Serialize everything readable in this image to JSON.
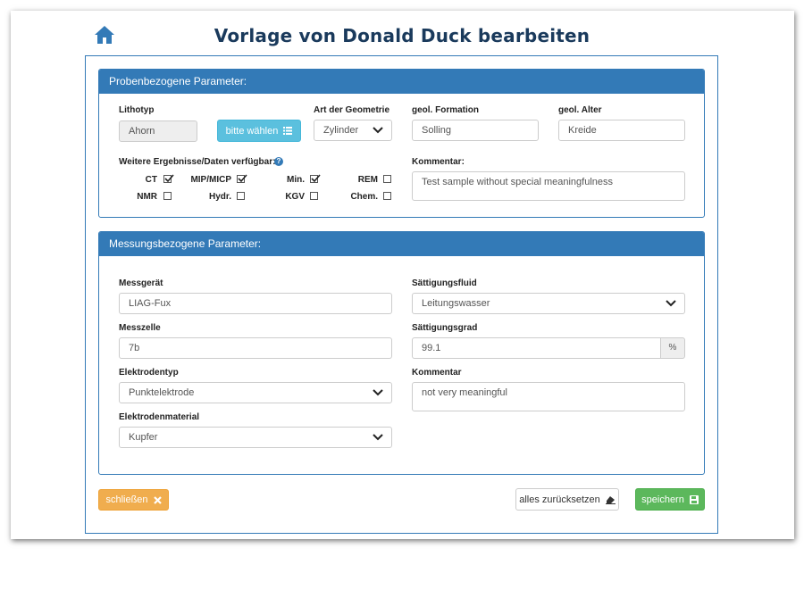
{
  "page": {
    "title": "Vorlage von Donald Duck bearbeiten"
  },
  "colors": {
    "primary": "#337ab7",
    "title": "#1a3a5c",
    "info": "#5bc0de",
    "warning": "#f0ad4e",
    "success": "#5cb85c"
  },
  "probe": {
    "heading": "Probenbezogene Parameter:",
    "lithotyp_label": "Lithotyp",
    "lithotyp_value": "Ahorn",
    "choose_button": "bitte wählen",
    "geometrie_label": "Art der Geometrie",
    "geometrie_value": "Zylinder",
    "formation_label": "geol. Formation",
    "formation_value": "Solling",
    "alter_label": "geol. Alter",
    "alter_value": "Kreide",
    "results_label": "Weitere Ergebnisse/Daten verfügbar:",
    "help_icon": "?",
    "checks": [
      {
        "label": "CT",
        "checked": true
      },
      {
        "label": "MIP/MICP",
        "checked": true
      },
      {
        "label": "Min.",
        "checked": true
      },
      {
        "label": "REM",
        "checked": false
      },
      {
        "label": "NMR",
        "checked": false
      },
      {
        "label": "Hydr.",
        "checked": false
      },
      {
        "label": "KGV",
        "checked": false
      },
      {
        "label": "Chem.",
        "checked": false
      }
    ],
    "comment_label": "Kommentar:",
    "comment_value": "Test sample without special meaningfulness"
  },
  "messung": {
    "heading": "Messungsbezogene Parameter:",
    "geraet_label": "Messgerät",
    "geraet_value": "LIAG-Fux",
    "zelle_label": "Messzelle",
    "zelle_value": "7b",
    "elektrodentyp_label": "Elektrodentyp",
    "elektrodentyp_value": "Punktelektrode",
    "elektrodenmaterial_label": "Elektrodenmaterial",
    "elektrodenmaterial_value": "Kupfer",
    "fluid_label": "Sättigungsfluid",
    "fluid_value": "Leitungswasser",
    "grad_label": "Sättigungsgrad",
    "grad_value": "99.1",
    "grad_unit": "%",
    "comment_label": "Kommentar",
    "comment_value": "not very meaningful"
  },
  "footer": {
    "close_label": "schließen",
    "reset_label": "alles zurücksetzen",
    "save_label": "speichern"
  }
}
